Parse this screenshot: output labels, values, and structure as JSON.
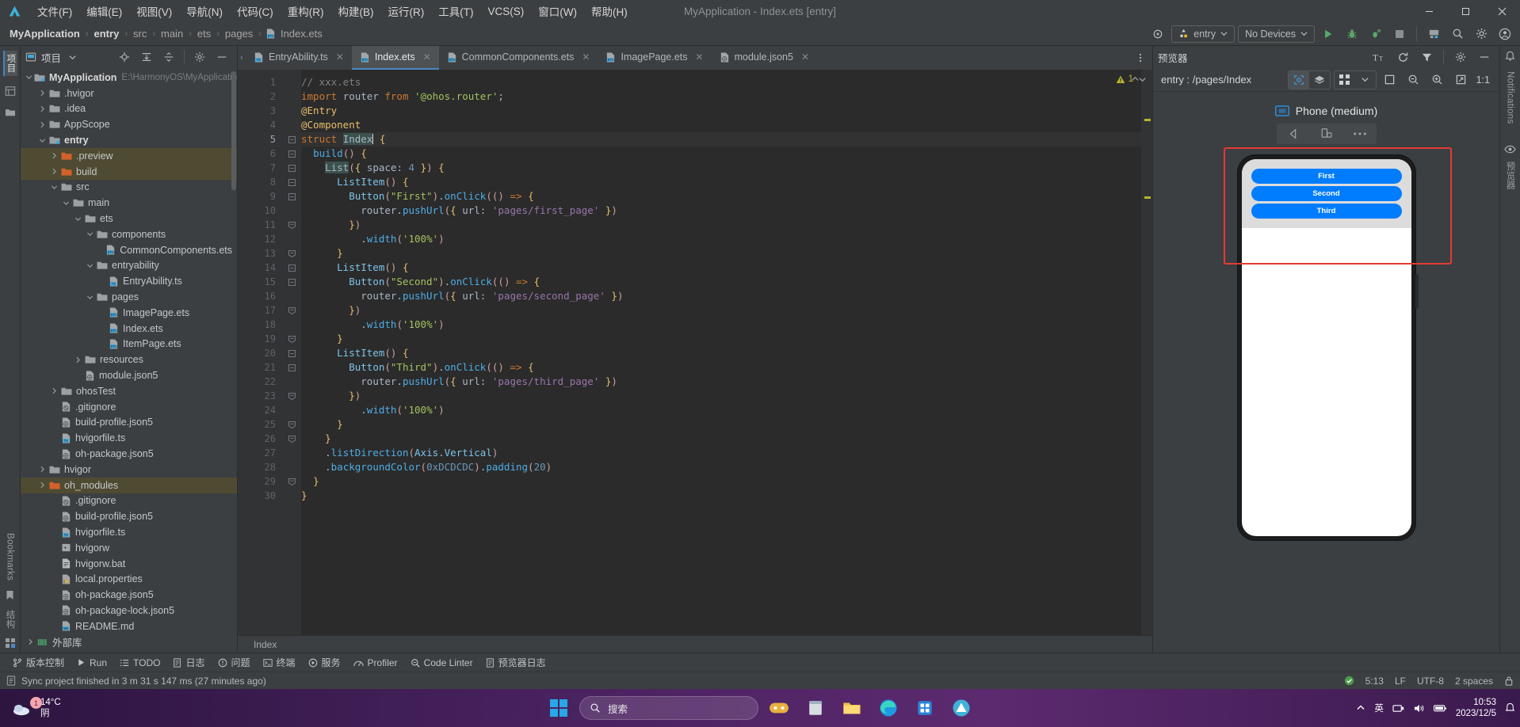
{
  "window": {
    "title": "MyApplication - Index.ets [entry]",
    "minimize": "—",
    "maximize": "❐",
    "close": "✕"
  },
  "menubar": {
    "items": [
      {
        "label": "文件(F)"
      },
      {
        "label": "编辑(E)"
      },
      {
        "label": "视图(V)"
      },
      {
        "label": "导航(N)"
      },
      {
        "label": "代码(C)"
      },
      {
        "label": "重构(R)"
      },
      {
        "label": "构建(B)"
      },
      {
        "label": "运行(R)"
      },
      {
        "label": "工具(T)"
      },
      {
        "label": "VCS(S)"
      },
      {
        "label": "窗口(W)"
      },
      {
        "label": "帮助(H)"
      }
    ]
  },
  "navbar": {
    "breadcrumbs": [
      "MyApplication",
      "entry",
      "src",
      "main",
      "ets",
      "pages",
      "Index.ets"
    ],
    "module_selector": "entry",
    "device_selector": "No Devices",
    "run_icon": "run-icon",
    "debug_icon": "debug-icon",
    "profile_icon": "profile-icon",
    "stop_icon": "stop-icon",
    "search_icon": "search-icon",
    "settings_icon": "gear-icon",
    "account_icon": "account-icon"
  },
  "project_panel": {
    "title": "项目",
    "tree": [
      {
        "indent": 0,
        "arrow": "down",
        "icon": "module-icon",
        "label": "MyApplication",
        "bold": true,
        "path": "E:\\HarmonyOS\\MyApplicatio",
        "highlight": false
      },
      {
        "indent": 1,
        "arrow": "right",
        "icon": "folder-icon",
        "label": ".hvigor",
        "highlight": false
      },
      {
        "indent": 1,
        "arrow": "right",
        "icon": "folder-icon",
        "label": ".idea",
        "highlight": false
      },
      {
        "indent": 1,
        "arrow": "right",
        "icon": "folder-icon",
        "label": "AppScope",
        "highlight": false
      },
      {
        "indent": 1,
        "arrow": "down",
        "icon": "module-icon",
        "label": "entry",
        "bold": true,
        "highlight": false
      },
      {
        "indent": 2,
        "arrow": "right",
        "icon": "folder-orange-icon",
        "label": ".preview",
        "highlight": true
      },
      {
        "indent": 2,
        "arrow": "right",
        "icon": "folder-orange-icon",
        "label": "build",
        "highlight": true
      },
      {
        "indent": 2,
        "arrow": "down",
        "icon": "folder-icon",
        "label": "src",
        "highlight": false
      },
      {
        "indent": 3,
        "arrow": "down",
        "icon": "folder-icon",
        "label": "main",
        "highlight": false
      },
      {
        "indent": 4,
        "arrow": "down",
        "icon": "folder-icon",
        "label": "ets",
        "highlight": false
      },
      {
        "indent": 5,
        "arrow": "down",
        "icon": "folder-icon",
        "label": "components",
        "highlight": false
      },
      {
        "indent": 6,
        "arrow": "none",
        "icon": "ets-file-icon",
        "label": "CommonComponents.ets",
        "highlight": false
      },
      {
        "indent": 5,
        "arrow": "down",
        "icon": "folder-icon",
        "label": "entryability",
        "highlight": false
      },
      {
        "indent": 6,
        "arrow": "none",
        "icon": "ts-file-icon",
        "label": "EntryAbility.ts",
        "highlight": false
      },
      {
        "indent": 5,
        "arrow": "down",
        "icon": "folder-icon",
        "label": "pages",
        "highlight": false
      },
      {
        "indent": 6,
        "arrow": "none",
        "icon": "ets-file-icon",
        "label": "ImagePage.ets",
        "highlight": false
      },
      {
        "indent": 6,
        "arrow": "none",
        "icon": "ets-file-icon",
        "label": "Index.ets",
        "highlight": false
      },
      {
        "indent": 6,
        "arrow": "none",
        "icon": "ets-file-icon",
        "label": "ItemPage.ets",
        "highlight": false
      },
      {
        "indent": 4,
        "arrow": "right",
        "icon": "folder-icon",
        "label": "resources",
        "highlight": false
      },
      {
        "indent": 4,
        "arrow": "none",
        "icon": "json-file-icon",
        "label": "module.json5",
        "highlight": false
      },
      {
        "indent": 2,
        "arrow": "right",
        "icon": "folder-icon",
        "label": "ohosTest",
        "highlight": false
      },
      {
        "indent": 2,
        "arrow": "none",
        "icon": "gitignore-icon",
        "label": ".gitignore",
        "highlight": false
      },
      {
        "indent": 2,
        "arrow": "none",
        "icon": "json-file-icon",
        "label": "build-profile.json5",
        "highlight": false
      },
      {
        "indent": 2,
        "arrow": "none",
        "icon": "ts-file-icon",
        "label": "hvigorfile.ts",
        "highlight": false
      },
      {
        "indent": 2,
        "arrow": "none",
        "icon": "json-file-icon",
        "label": "oh-package.json5",
        "highlight": false
      },
      {
        "indent": 1,
        "arrow": "right",
        "icon": "folder-icon",
        "label": "hvigor",
        "highlight": false
      },
      {
        "indent": 1,
        "arrow": "right",
        "icon": "folder-orange-icon",
        "label": "oh_modules",
        "highlight": true
      },
      {
        "indent": 2,
        "arrow": "none",
        "icon": "gitignore-icon",
        "label": ".gitignore",
        "highlight": false
      },
      {
        "indent": 2,
        "arrow": "none",
        "icon": "json-file-icon",
        "label": "build-profile.json5",
        "highlight": false
      },
      {
        "indent": 2,
        "arrow": "none",
        "icon": "ts-file-icon",
        "label": "hvigorfile.ts",
        "highlight": false
      },
      {
        "indent": 2,
        "arrow": "none",
        "icon": "script-icon",
        "label": "hvigorw",
        "highlight": false
      },
      {
        "indent": 2,
        "arrow": "none",
        "icon": "bat-file-icon",
        "label": "hvigorw.bat",
        "highlight": false
      },
      {
        "indent": 2,
        "arrow": "none",
        "icon": "properties-icon",
        "label": "local.properties",
        "highlight": false
      },
      {
        "indent": 2,
        "arrow": "none",
        "icon": "json-file-icon",
        "label": "oh-package.json5",
        "highlight": false
      },
      {
        "indent": 2,
        "arrow": "none",
        "icon": "json-file-icon",
        "label": "oh-package-lock.json5",
        "highlight": false
      },
      {
        "indent": 2,
        "arrow": "none",
        "icon": "md-file-icon",
        "label": "README.md",
        "highlight": false
      },
      {
        "indent": 0,
        "arrow": "right",
        "icon": "library-icon",
        "label": "外部库",
        "highlight": false
      }
    ]
  },
  "left_rail": [
    {
      "label": "项目",
      "selected": true,
      "icon": "project-icon"
    },
    {
      "label": "",
      "selected": false,
      "icon": "structure-icon"
    }
  ],
  "left_rail_bottom": [
    {
      "label": "Bookmarks",
      "icon": "bookmark-icon"
    },
    {
      "label": "结构",
      "icon": "structure-icon"
    }
  ],
  "editor": {
    "tabs": [
      {
        "label": "EntryAbility.ts",
        "icon": "ts-file-icon",
        "active": false
      },
      {
        "label": "Index.ets",
        "icon": "ets-file-icon",
        "active": true
      },
      {
        "label": "CommonComponents.ets",
        "icon": "ets-file-icon",
        "active": false
      },
      {
        "label": "ImagePage.ets",
        "icon": "ets-file-icon",
        "active": false
      },
      {
        "label": "module.json5",
        "icon": "json-file-icon",
        "active": false
      }
    ],
    "warning_count": "1",
    "breadcrumb_bottom": "Index",
    "line_count": 30,
    "cursor_line": 5,
    "lines": [
      {
        "n": 1,
        "fold": "",
        "html": "<span class='cmt'>// xxx.ets</span>"
      },
      {
        "n": 2,
        "fold": "",
        "html": "<span class='kw'>import</span> <span class='pn'>router</span> <span class='kw'>from</span> <span class='strq'>'@ohos.router'</span><span class='pn'>;</span>"
      },
      {
        "n": 3,
        "fold": "",
        "html": "<span class='kw2'>@Entry</span>"
      },
      {
        "n": 4,
        "fold": "",
        "html": "<span class='kw2'>@Component</span>"
      },
      {
        "n": 5,
        "fold": "minus",
        "html": "<span class='kw'>struct</span> <span class='hlident'>Index</span><span class='caret'></span> <span class='brc'>{</span>"
      },
      {
        "n": 6,
        "fold": "minus",
        "html": "  <span class='meth'>build</span><span class='par'>()</span> <span class='brc'>{</span>"
      },
      {
        "n": 7,
        "fold": "minus",
        "html": "    <span class='hlident'>List</span><span class='par'>(</span><span class='brc'>{</span> <span class='pn'>space:</span> <span class='num'>4</span> <span class='brc'>}</span><span class='par'>)</span> <span class='brc'>{</span>"
      },
      {
        "n": 8,
        "fold": "minus",
        "html": "      <span class='comp'>ListItem</span><span class='par'>()</span> <span class='brc'>{</span>"
      },
      {
        "n": 9,
        "fold": "minus",
        "html": "        <span class='comp'>Button</span><span class='par'>(</span><span class='strq'>\"First\"</span><span class='par'>)</span><span class='pn'>.</span><span class='meth'>onClick</span><span class='par'>((</span><span class='par'>)</span> <span class='op'>=&gt;</span> <span class='brc'>{</span>"
      },
      {
        "n": 10,
        "fold": "",
        "html": "          <span class='pn'>router</span><span class='pn'>.</span><span class='meth'>pushUrl</span><span class='par'>(</span><span class='brc'>{</span> <span class='pn'>url:</span> <span class='purple'>'pages/first_page'</span> <span class='brc'>}</span><span class='par'>)</span>"
      },
      {
        "n": 11,
        "fold": "plus",
        "html": "        <span class='brc'>}</span><span class='par'>)</span>"
      },
      {
        "n": 12,
        "fold": "",
        "html": "          <span class='pn'>.</span><span class='meth'>width</span><span class='par'>(</span><span class='strq'>'100%'</span><span class='par'>)</span>"
      },
      {
        "n": 13,
        "fold": "plus",
        "html": "      <span class='brc'>}</span>"
      },
      {
        "n": 14,
        "fold": "minus",
        "html": "      <span class='comp'>ListItem</span><span class='par'>()</span> <span class='brc'>{</span>"
      },
      {
        "n": 15,
        "fold": "minus",
        "html": "        <span class='comp'>Button</span><span class='par'>(</span><span class='strq'>\"Second\"</span><span class='par'>)</span><span class='pn'>.</span><span class='meth'>onClick</span><span class='par'>((</span><span class='par'>)</span> <span class='op'>=&gt;</span> <span class='brc'>{</span>"
      },
      {
        "n": 16,
        "fold": "",
        "html": "          <span class='pn'>router</span><span class='pn'>.</span><span class='meth'>pushUrl</span><span class='par'>(</span><span class='brc'>{</span> <span class='pn'>url:</span> <span class='purple'>'pages/second_page'</span> <span class='brc'>}</span><span class='par'>)</span>"
      },
      {
        "n": 17,
        "fold": "plus",
        "html": "        <span class='brc'>}</span><span class='par'>)</span>"
      },
      {
        "n": 18,
        "fold": "",
        "html": "          <span class='pn'>.</span><span class='meth'>width</span><span class='par'>(</span><span class='strq'>'100%'</span><span class='par'>)</span>"
      },
      {
        "n": 19,
        "fold": "plus",
        "html": "      <span class='brc'>}</span>"
      },
      {
        "n": 20,
        "fold": "minus",
        "html": "      <span class='comp'>ListItem</span><span class='par'>()</span> <span class='brc'>{</span>"
      },
      {
        "n": 21,
        "fold": "minus",
        "html": "        <span class='comp'>Button</span><span class='par'>(</span><span class='strq'>\"Third\"</span><span class='par'>)</span><span class='pn'>.</span><span class='meth'>onClick</span><span class='par'>((</span><span class='par'>)</span> <span class='op'>=&gt;</span> <span class='brc'>{</span>"
      },
      {
        "n": 22,
        "fold": "",
        "html": "          <span class='pn'>router</span><span class='pn'>.</span><span class='meth'>pushUrl</span><span class='par'>(</span><span class='brc'>{</span> <span class='pn'>url:</span> <span class='purple'>'pages/third_page'</span> <span class='brc'>}</span><span class='par'>)</span>"
      },
      {
        "n": 23,
        "fold": "plus",
        "html": "        <span class='brc'>}</span><span class='par'>)</span>"
      },
      {
        "n": 24,
        "fold": "",
        "html": "          <span class='pn'>.</span><span class='meth'>width</span><span class='par'>(</span><span class='strq'>'100%'</span><span class='par'>)</span>"
      },
      {
        "n": 25,
        "fold": "plus",
        "html": "      <span class='brc'>}</span>"
      },
      {
        "n": 26,
        "fold": "plus",
        "html": "    <span class='brc'>}</span>"
      },
      {
        "n": 27,
        "fold": "",
        "html": "    <span class='pn'>.</span><span class='meth'>listDirection</span><span class='par'>(</span><span class='comp'>Axis</span><span class='pn'>.</span><span class='comp'>Vertical</span><span class='par'>)</span>"
      },
      {
        "n": 28,
        "fold": "",
        "html": "    <span class='pn'>.</span><span class='meth'>backgroundColor</span><span class='par'>(</span><span class='num'>0xDCDCDC</span><span class='par'>)</span><span class='pn'>.</span><span class='meth'>padding</span><span class='par'>(</span><span class='num'>20</span><span class='par'>)</span>"
      },
      {
        "n": 29,
        "fold": "plus",
        "html": "  <span class='brc'>}</span>"
      },
      {
        "n": 30,
        "fold": "",
        "html": "<span class='brc'>}</span>"
      }
    ]
  },
  "preview": {
    "title": "预览器",
    "route": "entry : /pages/Index",
    "device_name": "Phone (medium)",
    "zoom_label": "1:1",
    "buttons": {
      "font_icon": "font-size-icon",
      "refresh_icon": "refresh-icon",
      "filter_icon": "filter-icon",
      "settings_icon": "gear-icon",
      "minimize_icon": "minimize-icon",
      "inspect_icon": "inspect-icon",
      "layers_icon": "layers-icon",
      "grid_icon": "grid-icon",
      "chevron_icon": "chevron-down-icon",
      "frame_icon": "frame-icon",
      "zoom_out_icon": "zoom-out-icon",
      "zoom_in_icon": "zoom-in-icon",
      "fit_icon": "fit-screen-icon",
      "rotate_icon": "rotate-icon",
      "device_icon": "device-icon",
      "more_icon": "more-icon"
    },
    "phone_buttons": [
      "First",
      "Second",
      "Third"
    ],
    "accent_color": "#007dff",
    "highlight_box_color": "#e53935",
    "list_background": "#DCDCDC"
  },
  "right_rail": [
    {
      "label": "Notifications",
      "icon": "bell-icon"
    },
    {
      "label": "预览器",
      "icon": "eye-icon"
    }
  ],
  "bottom_toolbar": [
    {
      "label": "版本控制",
      "icon": "branch-icon"
    },
    {
      "label": "Run",
      "icon": "run-icon"
    },
    {
      "label": "TODO",
      "icon": "todo-icon"
    },
    {
      "label": "日志",
      "icon": "log-icon"
    },
    {
      "label": "问题",
      "icon": "problems-icon"
    },
    {
      "label": "终端",
      "icon": "terminal-icon"
    },
    {
      "label": "服务",
      "icon": "services-icon"
    },
    {
      "label": "Profiler",
      "icon": "profiler-icon"
    },
    {
      "label": "Code Linter",
      "icon": "linter-icon"
    },
    {
      "label": "预览器日志",
      "icon": "preview-log-icon"
    }
  ],
  "statusbar": {
    "message": "Sync project finished in 3 m 31 s 147 ms (27 minutes ago)",
    "cursor_position": "5:13",
    "line_separator": "LF",
    "encoding": "UTF-8",
    "indent": "2 spaces",
    "lock_icon": "lock-icon",
    "sync_ok_icon": "green-check-icon"
  },
  "taskbar": {
    "weather_temp": "14°C",
    "weather_desc": "阴",
    "weather_badge": "1",
    "search_placeholder": "搜索",
    "time": "10:53",
    "date": "2023/12/5",
    "lang_indicator": "英",
    "apps": [
      {
        "name": "widgets-icon"
      },
      {
        "name": "search-icon"
      },
      {
        "name": "copilot-icon"
      },
      {
        "name": "notes-icon"
      },
      {
        "name": "explorer-icon"
      },
      {
        "name": "edge-icon"
      },
      {
        "name": "store-icon"
      },
      {
        "name": "deveco-icon"
      }
    ]
  }
}
